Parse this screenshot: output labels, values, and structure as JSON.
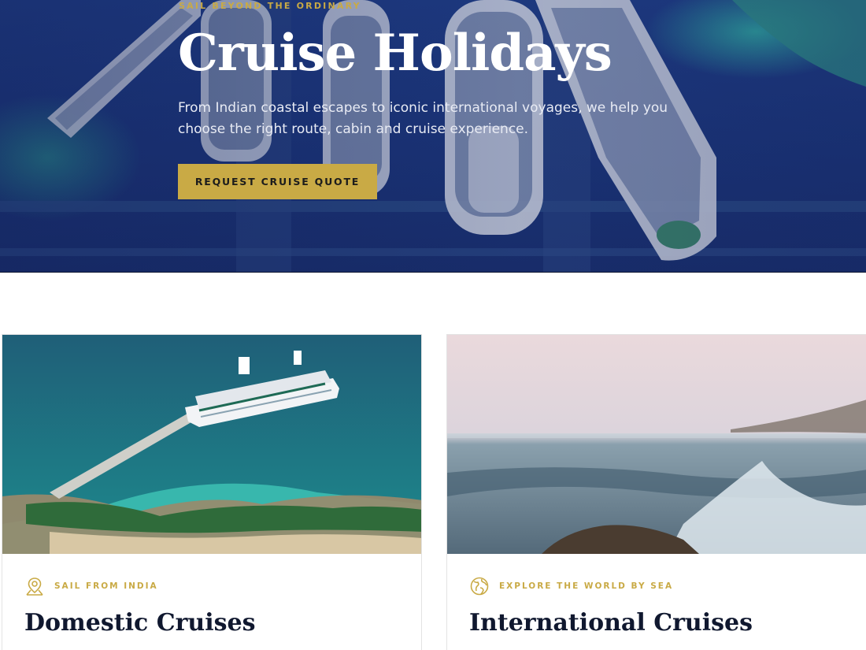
{
  "hero": {
    "eyebrow": "SAIL BEYOND THE ORDINARY",
    "title": "Cruise Holidays",
    "description": "From Indian coastal escapes to iconic international voyages, we help you choose the right route, cabin and cruise experience.",
    "cta_label": "REQUEST CRUISE QUOTE"
  },
  "cards": [
    {
      "eyebrow": "SAIL FROM INDIA",
      "title": "Domestic Cruises",
      "icon": "map-pin-icon"
    },
    {
      "eyebrow": "EXPLORE THE WORLD BY SEA",
      "title": "International Cruises",
      "icon": "globe-icon"
    }
  ],
  "colors": {
    "accent": "#c9aa45",
    "hero_overlay": "#1b357a",
    "heading_dark": "#10182f",
    "card_border": "#e3e3e3"
  }
}
